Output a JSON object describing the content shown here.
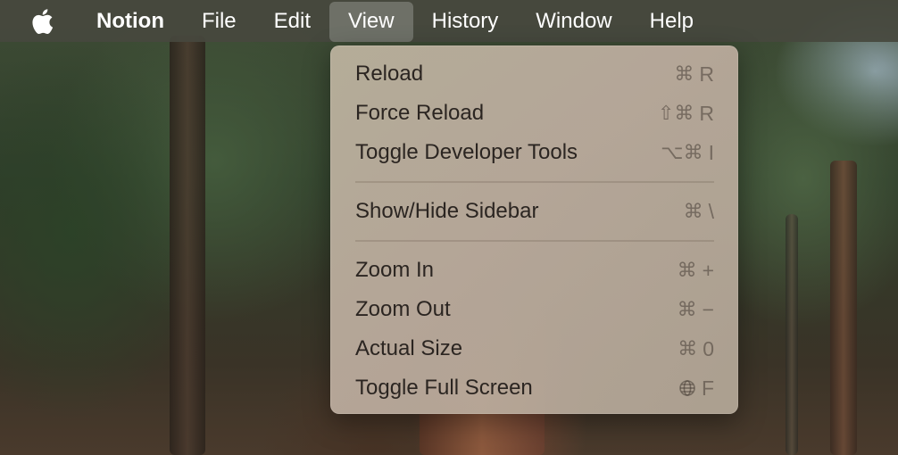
{
  "menubar": {
    "apple_icon": "apple-logo-icon",
    "app_name": "Notion",
    "items": [
      "File",
      "Edit",
      "View",
      "History",
      "Window",
      "Help"
    ],
    "active_item": "View"
  },
  "view_menu": {
    "groups": [
      [
        {
          "label": "Reload",
          "shortcut_mods": "⌘",
          "shortcut_key": "R"
        },
        {
          "label": "Force Reload",
          "shortcut_mods": "⇧⌘",
          "shortcut_key": "R"
        },
        {
          "label": "Toggle Developer Tools",
          "shortcut_mods": "⌥⌘",
          "shortcut_key": "I"
        }
      ],
      [
        {
          "label": "Show/Hide Sidebar",
          "shortcut_mods": "⌘",
          "shortcut_key": "\\"
        }
      ],
      [
        {
          "label": "Zoom In",
          "shortcut_mods": "⌘",
          "shortcut_key": "+"
        },
        {
          "label": "Zoom Out",
          "shortcut_mods": "⌘",
          "shortcut_key": "−"
        },
        {
          "label": "Actual Size",
          "shortcut_mods": "⌘",
          "shortcut_key": "0"
        },
        {
          "label": "Toggle Full Screen",
          "shortcut_mods": "globe-icon",
          "shortcut_key": "F"
        }
      ]
    ]
  }
}
